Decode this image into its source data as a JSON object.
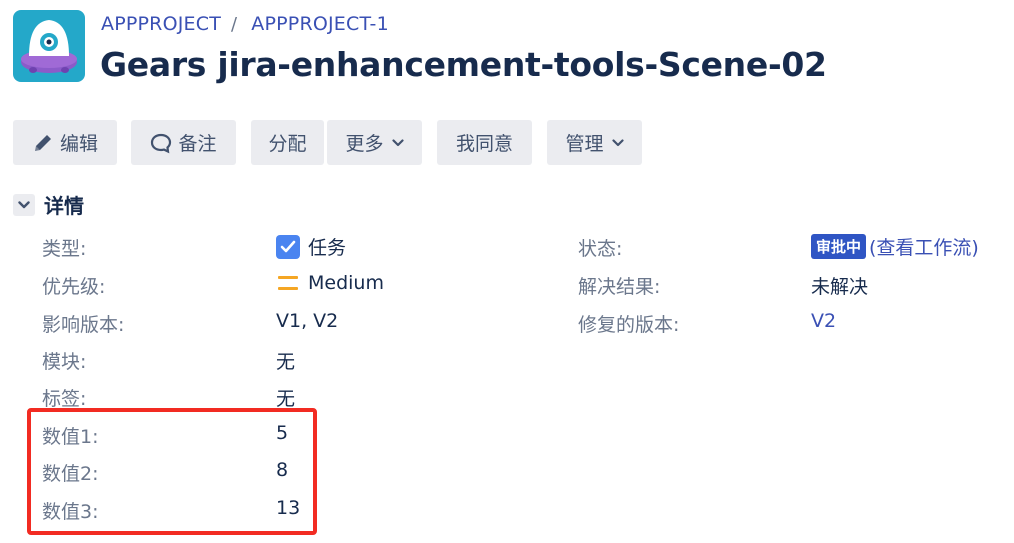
{
  "breadcrumb": {
    "project": "APPPROJECT",
    "separator": "/",
    "issue_key": "APPPROJECT-1"
  },
  "issue": {
    "title": "Gears jira-enhancement-tools-Scene-02"
  },
  "toolbar": {
    "edit": "编辑",
    "comment": "备注",
    "assign": "分配",
    "more": "更多",
    "agree": "我同意",
    "admin": "管理"
  },
  "details": {
    "title": "详情",
    "left": [
      {
        "label": "类型:",
        "value": "任务"
      },
      {
        "label": "优先级:",
        "value": "Medium"
      },
      {
        "label": "影响版本:",
        "value": "V1, V2"
      },
      {
        "label": "模块:",
        "value": "无"
      },
      {
        "label": "标签:",
        "value": "无"
      },
      {
        "label": "数值1:",
        "value": "5"
      },
      {
        "label": "数值2:",
        "value": "8"
      },
      {
        "label": "数值3:",
        "value": "13"
      }
    ],
    "right": [
      {
        "label": "状态:",
        "badge": "审批中",
        "link": "(查看工作流)"
      },
      {
        "label": "解决结果:",
        "value": "未解决"
      },
      {
        "label": "修复的版本:",
        "value": "V2"
      }
    ]
  },
  "colors": {
    "link": "#3a50b4",
    "status_badge": "#2f55c4",
    "highlight": "#f22b22",
    "priority": "#f5a623",
    "issue_type": "#4a84f0"
  },
  "icons": {
    "avatar": "project-avatar-icon",
    "edit": "pencil-icon",
    "comment": "comment-bubble-icon",
    "dropdown": "chevron-down-icon",
    "issue_type": "task-check-icon",
    "priority": "priority-medium-icon"
  }
}
